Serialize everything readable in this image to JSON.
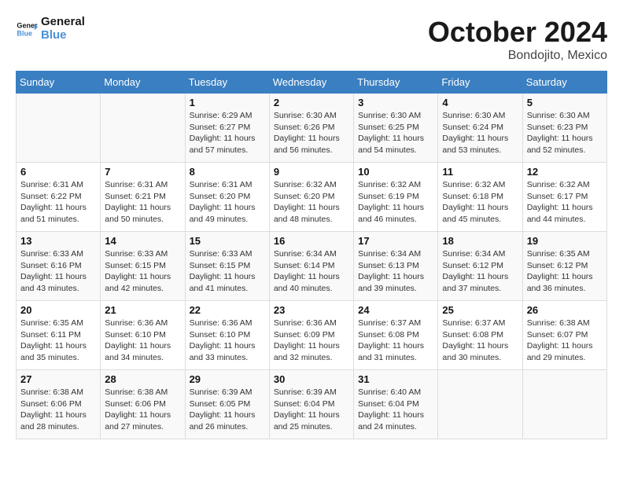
{
  "header": {
    "logo_general": "General",
    "logo_blue": "Blue",
    "month_title": "October 2024",
    "location": "Bondojito, Mexico"
  },
  "days_of_week": [
    "Sunday",
    "Monday",
    "Tuesday",
    "Wednesday",
    "Thursday",
    "Friday",
    "Saturday"
  ],
  "weeks": [
    [
      {
        "day": "",
        "info": ""
      },
      {
        "day": "",
        "info": ""
      },
      {
        "day": "1",
        "info": "Sunrise: 6:29 AM\nSunset: 6:27 PM\nDaylight: 11 hours and 57 minutes."
      },
      {
        "day": "2",
        "info": "Sunrise: 6:30 AM\nSunset: 6:26 PM\nDaylight: 11 hours and 56 minutes."
      },
      {
        "day": "3",
        "info": "Sunrise: 6:30 AM\nSunset: 6:25 PM\nDaylight: 11 hours and 54 minutes."
      },
      {
        "day": "4",
        "info": "Sunrise: 6:30 AM\nSunset: 6:24 PM\nDaylight: 11 hours and 53 minutes."
      },
      {
        "day": "5",
        "info": "Sunrise: 6:30 AM\nSunset: 6:23 PM\nDaylight: 11 hours and 52 minutes."
      }
    ],
    [
      {
        "day": "6",
        "info": "Sunrise: 6:31 AM\nSunset: 6:22 PM\nDaylight: 11 hours and 51 minutes."
      },
      {
        "day": "7",
        "info": "Sunrise: 6:31 AM\nSunset: 6:21 PM\nDaylight: 11 hours and 50 minutes."
      },
      {
        "day": "8",
        "info": "Sunrise: 6:31 AM\nSunset: 6:20 PM\nDaylight: 11 hours and 49 minutes."
      },
      {
        "day": "9",
        "info": "Sunrise: 6:32 AM\nSunset: 6:20 PM\nDaylight: 11 hours and 48 minutes."
      },
      {
        "day": "10",
        "info": "Sunrise: 6:32 AM\nSunset: 6:19 PM\nDaylight: 11 hours and 46 minutes."
      },
      {
        "day": "11",
        "info": "Sunrise: 6:32 AM\nSunset: 6:18 PM\nDaylight: 11 hours and 45 minutes."
      },
      {
        "day": "12",
        "info": "Sunrise: 6:32 AM\nSunset: 6:17 PM\nDaylight: 11 hours and 44 minutes."
      }
    ],
    [
      {
        "day": "13",
        "info": "Sunrise: 6:33 AM\nSunset: 6:16 PM\nDaylight: 11 hours and 43 minutes."
      },
      {
        "day": "14",
        "info": "Sunrise: 6:33 AM\nSunset: 6:15 PM\nDaylight: 11 hours and 42 minutes."
      },
      {
        "day": "15",
        "info": "Sunrise: 6:33 AM\nSunset: 6:15 PM\nDaylight: 11 hours and 41 minutes."
      },
      {
        "day": "16",
        "info": "Sunrise: 6:34 AM\nSunset: 6:14 PM\nDaylight: 11 hours and 40 minutes."
      },
      {
        "day": "17",
        "info": "Sunrise: 6:34 AM\nSunset: 6:13 PM\nDaylight: 11 hours and 39 minutes."
      },
      {
        "day": "18",
        "info": "Sunrise: 6:34 AM\nSunset: 6:12 PM\nDaylight: 11 hours and 37 minutes."
      },
      {
        "day": "19",
        "info": "Sunrise: 6:35 AM\nSunset: 6:12 PM\nDaylight: 11 hours and 36 minutes."
      }
    ],
    [
      {
        "day": "20",
        "info": "Sunrise: 6:35 AM\nSunset: 6:11 PM\nDaylight: 11 hours and 35 minutes."
      },
      {
        "day": "21",
        "info": "Sunrise: 6:36 AM\nSunset: 6:10 PM\nDaylight: 11 hours and 34 minutes."
      },
      {
        "day": "22",
        "info": "Sunrise: 6:36 AM\nSunset: 6:10 PM\nDaylight: 11 hours and 33 minutes."
      },
      {
        "day": "23",
        "info": "Sunrise: 6:36 AM\nSunset: 6:09 PM\nDaylight: 11 hours and 32 minutes."
      },
      {
        "day": "24",
        "info": "Sunrise: 6:37 AM\nSunset: 6:08 PM\nDaylight: 11 hours and 31 minutes."
      },
      {
        "day": "25",
        "info": "Sunrise: 6:37 AM\nSunset: 6:08 PM\nDaylight: 11 hours and 30 minutes."
      },
      {
        "day": "26",
        "info": "Sunrise: 6:38 AM\nSunset: 6:07 PM\nDaylight: 11 hours and 29 minutes."
      }
    ],
    [
      {
        "day": "27",
        "info": "Sunrise: 6:38 AM\nSunset: 6:06 PM\nDaylight: 11 hours and 28 minutes."
      },
      {
        "day": "28",
        "info": "Sunrise: 6:38 AM\nSunset: 6:06 PM\nDaylight: 11 hours and 27 minutes."
      },
      {
        "day": "29",
        "info": "Sunrise: 6:39 AM\nSunset: 6:05 PM\nDaylight: 11 hours and 26 minutes."
      },
      {
        "day": "30",
        "info": "Sunrise: 6:39 AM\nSunset: 6:04 PM\nDaylight: 11 hours and 25 minutes."
      },
      {
        "day": "31",
        "info": "Sunrise: 6:40 AM\nSunset: 6:04 PM\nDaylight: 11 hours and 24 minutes."
      },
      {
        "day": "",
        "info": ""
      },
      {
        "day": "",
        "info": ""
      }
    ]
  ]
}
